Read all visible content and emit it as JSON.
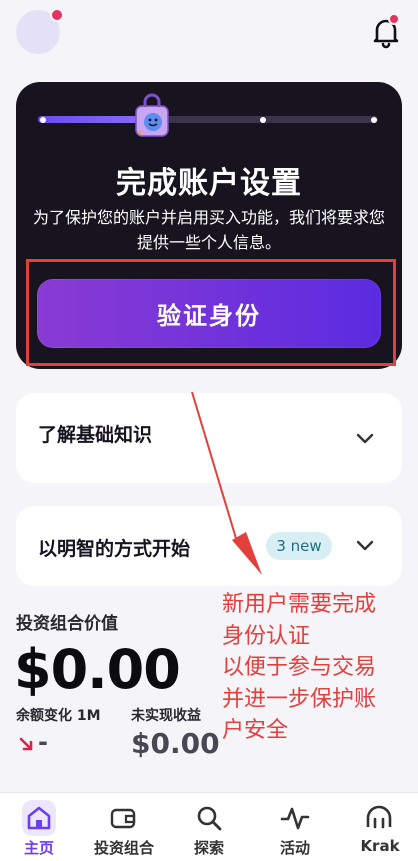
{
  "setup_card": {
    "progress": 0.33,
    "title": "完成账户设置",
    "description": "为了保护您的账户并启用买入功能，我们将要求您提供一些个人信息。",
    "button": "验证身份"
  },
  "cards": {
    "basics": "了解基础知识",
    "smart_start": "以明智的方式开始",
    "new_badge": "3 new"
  },
  "portfolio": {
    "label": "投资组合价值",
    "value": "$0.00",
    "balance_change_label": "余额变化 1M",
    "balance_change_value": "-",
    "unrealized_label": "未实现收益",
    "unrealized_value": "$0.00"
  },
  "annotation": "新用户需要完成\n身份认证\n以便于参与交易\n并进一步保护账\n户安全",
  "nav": {
    "home": "主页",
    "portfolio": "投资组合",
    "explore": "探索",
    "activity": "活动",
    "krak": "Krak"
  },
  "colors": {
    "accent": "#6b3ff0",
    "card_dark": "#17141f",
    "annotation_red": "#e2403c",
    "notify_red": "#e5335f"
  }
}
